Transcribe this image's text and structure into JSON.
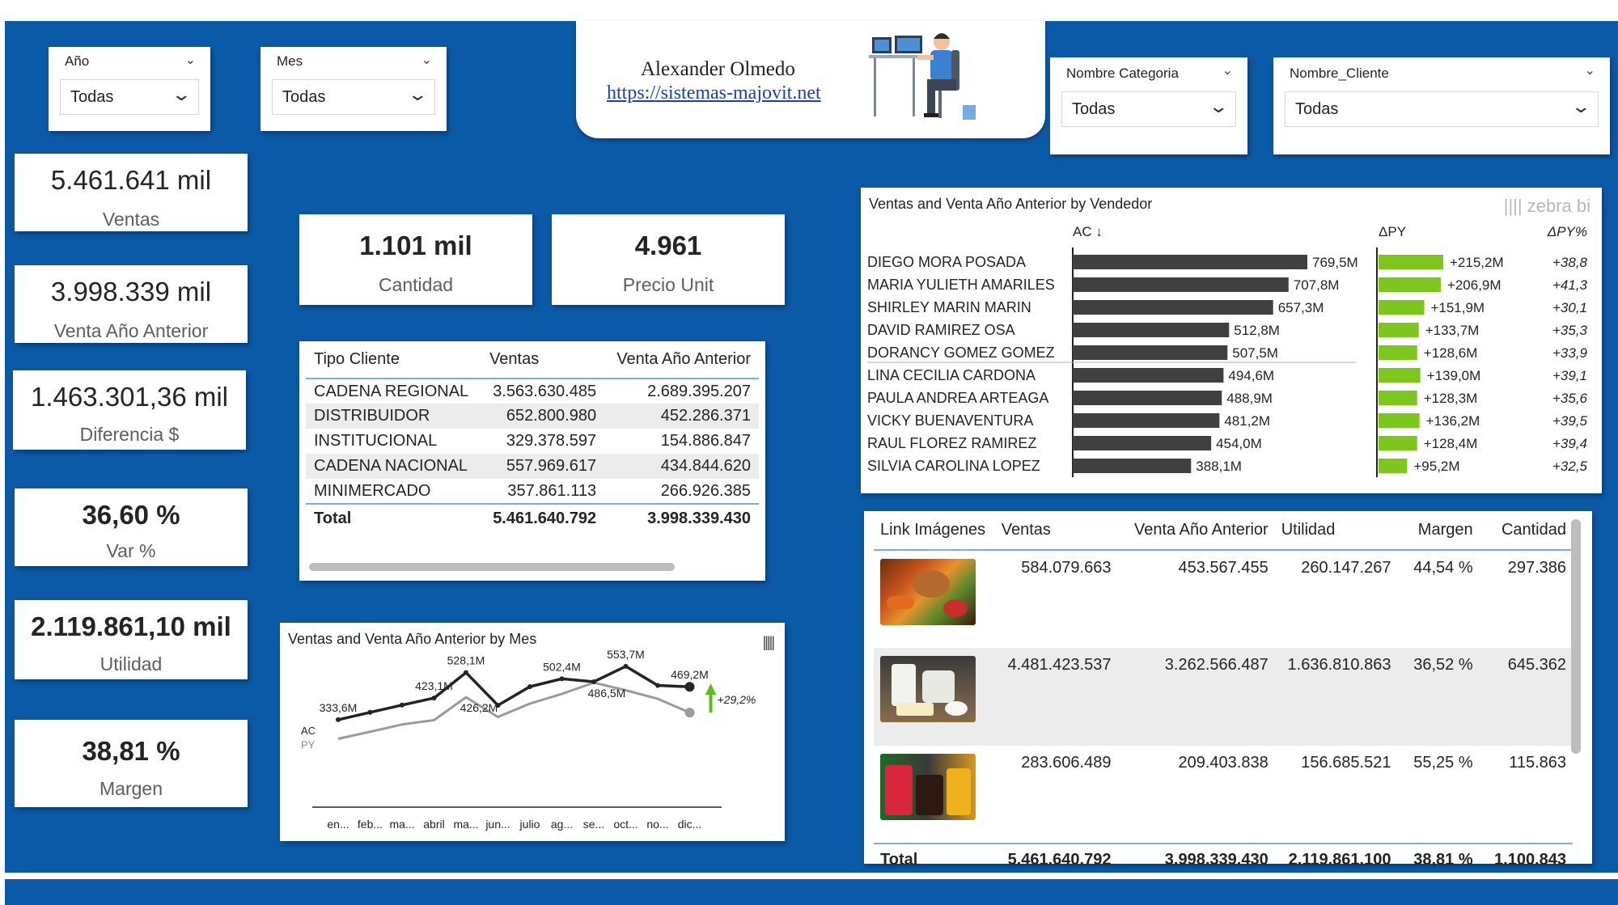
{
  "slicers": {
    "anio": {
      "title": "Año",
      "value": "Todas"
    },
    "mes": {
      "title": "Mes",
      "value": "Todas"
    },
    "categoria": {
      "title": "Nombre Categoria",
      "value": "Todas"
    },
    "cliente": {
      "title": "Nombre_Cliente",
      "value": "Todas"
    }
  },
  "banner": {
    "name": "Alexander Olmedo",
    "link": "https://sistemas-majovit.net"
  },
  "kpis": {
    "ventas": {
      "value": "5.461.641 mil",
      "label": "Ventas"
    },
    "venta_anterior": {
      "value": "3.998.339 mil",
      "label": "Venta Año Anterior"
    },
    "diferencia": {
      "value": "1.463.301,36 mil",
      "label": "Diferencia $"
    },
    "var": {
      "value": "36,60 %",
      "label": "Var %"
    },
    "utilidad": {
      "value": "2.119.861,10 mil",
      "label": "Utilidad"
    },
    "margen": {
      "value": "38,81 %",
      "label": "Margen"
    },
    "cantidad": {
      "value": "1.101 mil",
      "label": "Cantidad"
    },
    "precio": {
      "value": "4.961",
      "label": "Precio Unit"
    }
  },
  "tipo_cliente_table": {
    "headers": [
      "Tipo Cliente",
      "Ventas",
      "Venta Año Anterior"
    ],
    "rows": [
      [
        "CADENA REGIONAL",
        "3.563.630.485",
        "2.689.395.207"
      ],
      [
        "DISTRIBUIDOR",
        "652.800.980",
        "452.286.371"
      ],
      [
        "INSTITUCIONAL",
        "329.378.597",
        "154.886.847"
      ],
      [
        "CADENA NACIONAL",
        "557.969.617",
        "434.844.620"
      ],
      [
        "MINIMERCADO",
        "357.861.113",
        "266.926.385"
      ]
    ],
    "total": [
      "Total",
      "5.461.640.792",
      "3.998.339.430"
    ]
  },
  "product_table": {
    "headers": [
      "Link Imágenes",
      "Ventas",
      "Venta Año Anterior",
      "Utilidad",
      "Margen",
      "Cantidad"
    ],
    "rows": [
      [
        "584.079.663",
        "453.567.455",
        "260.147.267",
        "44,54 %",
        "297.386"
      ],
      [
        "4.481.423.537",
        "3.262.566.487",
        "1.636.810.863",
        "36,52 %",
        "645.362"
      ],
      [
        "283.606.489",
        "209.403.838",
        "156.685.521",
        "55,25 %",
        "115.863"
      ]
    ],
    "total": [
      "Total",
      "5.461.640.792",
      "3.998.339.430",
      "2.119.861.100",
      "38,81 %",
      "1.100.843"
    ],
    "images": [
      "meat-and-vegetables-photo",
      "dairy-products-photo",
      "beverages-photo"
    ]
  },
  "chart_data": [
    {
      "type": "bar",
      "title": "Ventas and Venta Año Anterior by Vendedor",
      "brand": "zebra bi",
      "ac_header": "AC ↓",
      "dpy_header": "ΔPY",
      "dpyp_header": "ΔPY%",
      "categories": [
        "DIEGO MORA POSADA",
        "MARIA YULIETH AMARILES",
        "SHIRLEY MARIN MARIN",
        "DAVID RAMIREZ OSA",
        "DORANCY GOMEZ GOMEZ",
        "LINA CECILIA CARDONA",
        "PAULA ANDREA ARTEAGA",
        "VICKY BUENAVENTURA",
        "RAUL FLOREZ RAMIREZ",
        "SILVIA CAROLINA LOPEZ"
      ],
      "series": [
        {
          "name": "AC",
          "values": [
            769.5,
            707.8,
            657.3,
            512.8,
            507.5,
            494.6,
            488.9,
            481.2,
            454.0,
            388.1
          ],
          "labels": [
            "769,5M",
            "707,8M",
            "657,3M",
            "512,8M",
            "507,5M",
            "494,6M",
            "488,9M",
            "481,2M",
            "454,0M",
            "388,1M"
          ]
        },
        {
          "name": "ΔPY",
          "values": [
            215.2,
            206.9,
            151.9,
            133.7,
            128.6,
            139.0,
            128.3,
            136.2,
            128.4,
            95.2
          ],
          "labels": [
            "+215,2M",
            "+206,9M",
            "+151,9M",
            "+133,7M",
            "+128,6M",
            "+139,0M",
            "+128,3M",
            "+136,2M",
            "+128,4M",
            "+95,2M"
          ]
        },
        {
          "name": "ΔPY%",
          "values": [
            38.8,
            41.3,
            30.1,
            35.3,
            33.9,
            39.1,
            35.6,
            39.5,
            39.4,
            32.5
          ],
          "labels": [
            "+38,8",
            "+41,3",
            "+30,1",
            "+35,3",
            "+33,9",
            "+39,1",
            "+35,6",
            "+39,5",
            "+39,4",
            "+32,5"
          ]
        }
      ]
    },
    {
      "type": "line",
      "title": "Ventas and Venta Año Anterior by Mes",
      "categories": [
        "en...",
        "feb...",
        "ma...",
        "abril",
        "ma...",
        "jun...",
        "julio",
        "ag...",
        "se...",
        "oct...",
        "no...",
        "dic..."
      ],
      "series": [
        {
          "name": "AC",
          "values": [
            333.6,
            364,
            394,
            423.1,
            528.1,
            393,
            470,
            502.4,
            490,
            553.7,
            475,
            469.2
          ]
        },
        {
          "name": "PY",
          "values": [
            255,
            284,
            314,
            332,
            426.2,
            345,
            400,
            440,
            486.5,
            455,
            420,
            363
          ]
        }
      ],
      "point_labels": {
        "AC": [
          "333,6M",
          "423,1M",
          "528,1M",
          "502,4M",
          "553,7M",
          "469,2M"
        ],
        "PY": [
          "426,2M",
          "486,5M"
        ]
      },
      "variance_label": "+29,2%",
      "colors": {
        "ac": "#252423",
        "py": "#9b9b9b",
        "variance": "#5cbd1f"
      }
    }
  ],
  "colors": {
    "background": "#0b5aa7",
    "bar": "#404040",
    "positive": "#7dc61e"
  }
}
